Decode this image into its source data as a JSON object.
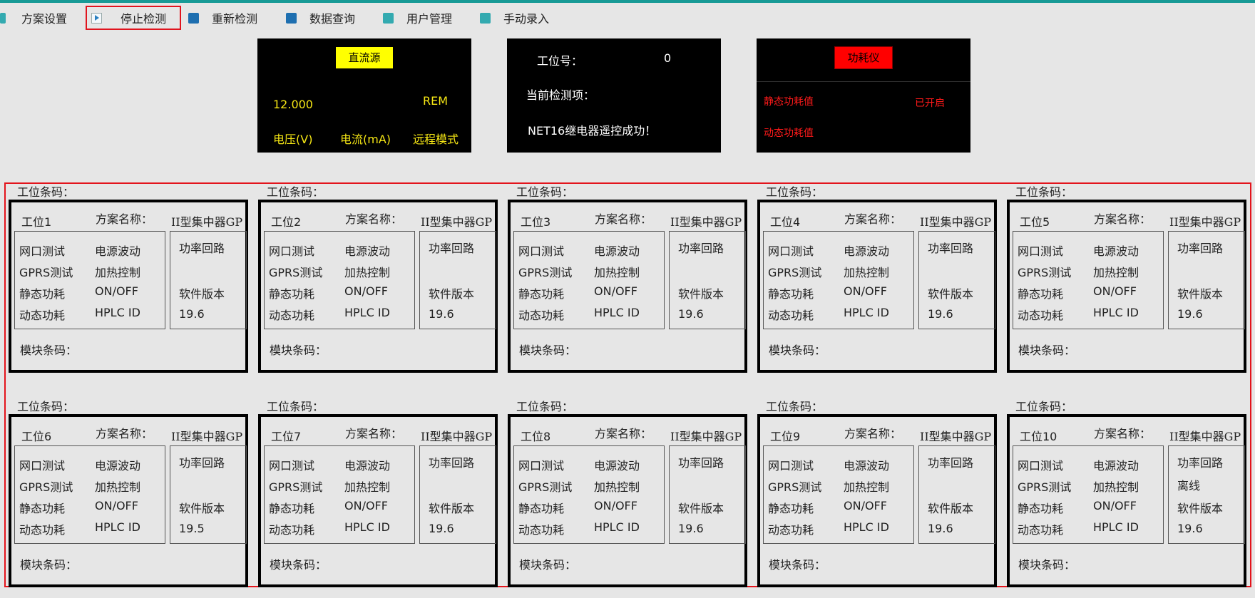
{
  "toolbar": {
    "items": [
      {
        "label": "方案设置"
      },
      {
        "label": "停止检测"
      },
      {
        "label": "重新检测"
      },
      {
        "label": "数据查询"
      },
      {
        "label": "用户管理"
      },
      {
        "label": "手动录入"
      }
    ]
  },
  "dc_source": {
    "title": "直流源",
    "voltage_value": "12.000",
    "mode_value": "REM",
    "voltage_label": "电压(V)",
    "current_label": "电流(mA)",
    "mode_label": "远程模式",
    "title_bg": "#ffff00"
  },
  "status": {
    "station_label": "工位号：",
    "station_value": "0",
    "current_item_label": "当前检测项：",
    "message": "NET16继电器遥控成功！"
  },
  "power_meter": {
    "title": "功耗仪",
    "static_label": "静态功耗值",
    "static_value": "已开启",
    "dynamic_label": "动态功耗值",
    "title_bg": "#ff0000"
  },
  "station_labels": {
    "barcode": "工位条码：",
    "plan": "方案名称：",
    "module": "模块条码：",
    "tests_left": [
      "网口测试",
      "GPRS测试",
      "静态功耗",
      "动态功耗"
    ],
    "tests_mid": [
      "电源波动",
      "加热控制",
      "ON/OFF",
      "HPLC ID"
    ],
    "power_loop": "功率回路",
    "sw_version": "软件版本"
  },
  "stations": [
    {
      "name": "工位1",
      "plan": "II型集中器GPRS",
      "loop_status": "",
      "version": "19.6"
    },
    {
      "name": "工位2",
      "plan": "II型集中器GPRS",
      "loop_status": "",
      "version": "19.6"
    },
    {
      "name": "工位3",
      "plan": "II型集中器GPRS",
      "loop_status": "",
      "version": "19.6"
    },
    {
      "name": "工位4",
      "plan": "II型集中器GPRS",
      "loop_status": "",
      "version": "19.6"
    },
    {
      "name": "工位5",
      "plan": "II型集中器GPRS",
      "loop_status": "",
      "version": "19.6"
    },
    {
      "name": "工位6",
      "plan": "II型集中器GPRS",
      "loop_status": "",
      "version": "19.5"
    },
    {
      "name": "工位7",
      "plan": "II型集中器GPRS",
      "loop_status": "",
      "version": "19.6"
    },
    {
      "name": "工位8",
      "plan": "II型集中器GPRS",
      "loop_status": "",
      "version": "19.6"
    },
    {
      "name": "工位9",
      "plan": "II型集中器GPRS",
      "loop_status": "",
      "version": "19.6"
    },
    {
      "name": "工位10",
      "plan": "II型集中器GPRS",
      "loop_status": "离线",
      "version": "19.6"
    }
  ]
}
